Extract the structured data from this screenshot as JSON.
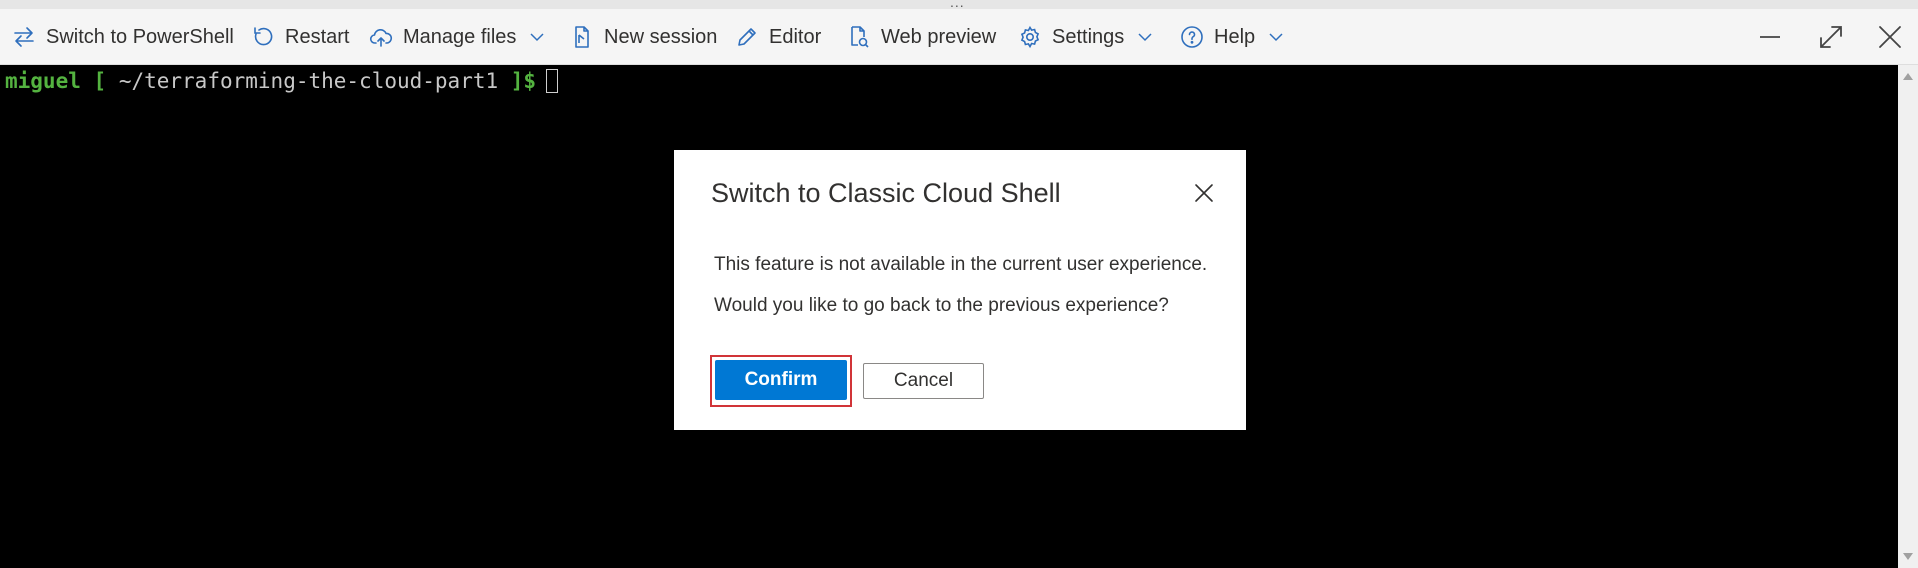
{
  "toolbar": {
    "switch_shell_label": "Switch to PowerShell",
    "restart_label": "Restart",
    "manage_files_label": "Manage files",
    "new_session_label": "New session",
    "editor_label": "Editor",
    "web_preview_label": "Web preview",
    "settings_label": "Settings",
    "help_label": "Help"
  },
  "topbar": {
    "dots": "..."
  },
  "terminal": {
    "user": "miguel",
    "open_bracket": "[",
    "path": "~/terraforming-the-cloud-part1",
    "close_bracket": "]$"
  },
  "dialog": {
    "title": "Switch to Classic Cloud Shell",
    "message_line1": "This feature is not available in the current user experience.",
    "message_line2": "Would you like to go back to the previous experience?",
    "confirm_label": "Confirm",
    "cancel_label": "Cancel"
  },
  "colors": {
    "accent": "#0078d4",
    "icon_blue": "#2f6fbd",
    "prompt_green": "#54b340",
    "focus_red": "#d13438",
    "terminal_bg": "#000000"
  }
}
